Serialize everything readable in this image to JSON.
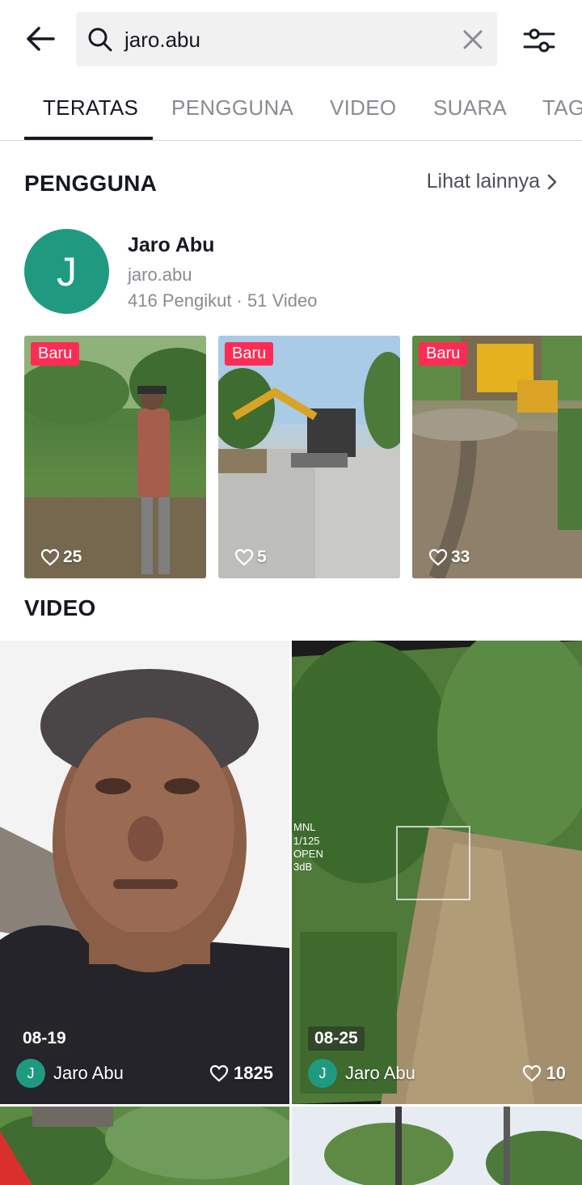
{
  "search": {
    "query": "jaro.abu"
  },
  "tabs": [
    {
      "label": "TERATAS"
    },
    {
      "label": "PENGGUNA"
    },
    {
      "label": "VIDEO"
    },
    {
      "label": "SUARA"
    },
    {
      "label": "TAG"
    }
  ],
  "users_section": {
    "title": "PENGGUNA",
    "see_more": "Lihat lainnya",
    "user": {
      "initial": "J",
      "name": "Jaro Abu",
      "handle": "jaro.abu",
      "stats": "416 Pengikut · 51 Video"
    },
    "thumbnails": [
      {
        "badge": "Baru",
        "likes": "25"
      },
      {
        "badge": "Baru",
        "likes": "5"
      },
      {
        "badge": "Baru",
        "likes": "33"
      }
    ]
  },
  "videos_section": {
    "title": "VIDEO",
    "videos": [
      {
        "date": "08-19",
        "author_initial": "J",
        "author": "Jaro Abu",
        "likes": "1825"
      },
      {
        "date": "08-25",
        "author_initial": "J",
        "author": "Jaro Abu",
        "likes": "10"
      }
    ]
  },
  "colors": {
    "accent_badge": "#fe2c55",
    "avatar": "#1f9a80"
  }
}
